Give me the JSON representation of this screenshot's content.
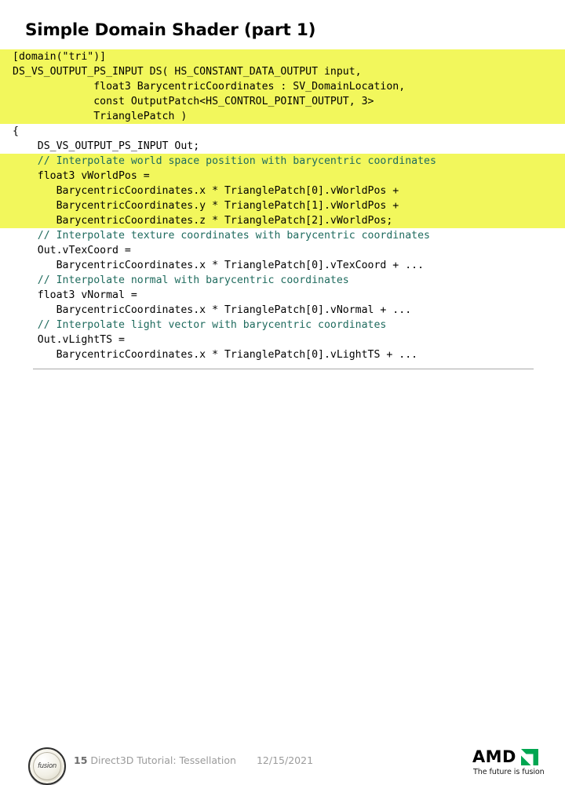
{
  "slide": {
    "title": "Simple Domain Shader (part 1)"
  },
  "code": {
    "lines": [
      {
        "text": "[domain(\"tri\")]",
        "highlight": true,
        "comment": false
      },
      {
        "text": "DS_VS_OUTPUT_PS_INPUT DS( HS_CONSTANT_DATA_OUTPUT input,",
        "highlight": true,
        "comment": false
      },
      {
        "text": "             float3 BarycentricCoordinates : SV_DomainLocation,",
        "highlight": true,
        "comment": false
      },
      {
        "text": "             const OutputPatch<HS_CONTROL_POINT_OUTPUT, 3>",
        "highlight": true,
        "comment": false
      },
      {
        "text": "             TrianglePatch )",
        "highlight": true,
        "comment": false
      },
      {
        "text": "{",
        "highlight": false,
        "comment": false
      },
      {
        "text": "    DS_VS_OUTPUT_PS_INPUT Out;",
        "highlight": false,
        "comment": false
      },
      {
        "text": "    // Interpolate world space position with barycentric coordinates",
        "highlight": true,
        "comment": true
      },
      {
        "text": "    float3 vWorldPos =",
        "highlight": true,
        "comment": false
      },
      {
        "text": "       BarycentricCoordinates.x * TrianglePatch[0].vWorldPos +",
        "highlight": true,
        "comment": false
      },
      {
        "text": "       BarycentricCoordinates.y * TrianglePatch[1].vWorldPos +",
        "highlight": true,
        "comment": false
      },
      {
        "text": "       BarycentricCoordinates.z * TrianglePatch[2].vWorldPos;",
        "highlight": true,
        "comment": false
      },
      {
        "text": "    // Interpolate texture coordinates with barycentric coordinates",
        "highlight": false,
        "comment": true
      },
      {
        "text": "    Out.vTexCoord =",
        "highlight": false,
        "comment": false
      },
      {
        "text": "       BarycentricCoordinates.x * TrianglePatch[0].vTexCoord + ...",
        "highlight": false,
        "comment": false
      },
      {
        "text": "    // Interpolate normal with barycentric coordinates",
        "highlight": false,
        "comment": true
      },
      {
        "text": "    float3 vNormal =",
        "highlight": false,
        "comment": false
      },
      {
        "text": "       BarycentricCoordinates.x * TrianglePatch[0].vNormal + ...",
        "highlight": false,
        "comment": false
      },
      {
        "text": "    // Interpolate light vector with barycentric coordinates",
        "highlight": false,
        "comment": true
      },
      {
        "text": "    Out.vLightTS =",
        "highlight": false,
        "comment": false
      },
      {
        "text": "       BarycentricCoordinates.x * TrianglePatch[0].vLightTS + ...",
        "highlight": false,
        "comment": false
      }
    ]
  },
  "footer": {
    "badge_text": "fusion",
    "slide_number": "15",
    "deck_title": "Direct3D Tutorial: Tessellation",
    "date": "12/15/2021",
    "amd_wordmark": "AMD",
    "amd_tagline": "The future is fusion"
  },
  "colors": {
    "highlight": "#f2f75c",
    "comment": "#1f6b5e",
    "amd_green": "#00a651",
    "footer_text": "#9b9b9b"
  }
}
